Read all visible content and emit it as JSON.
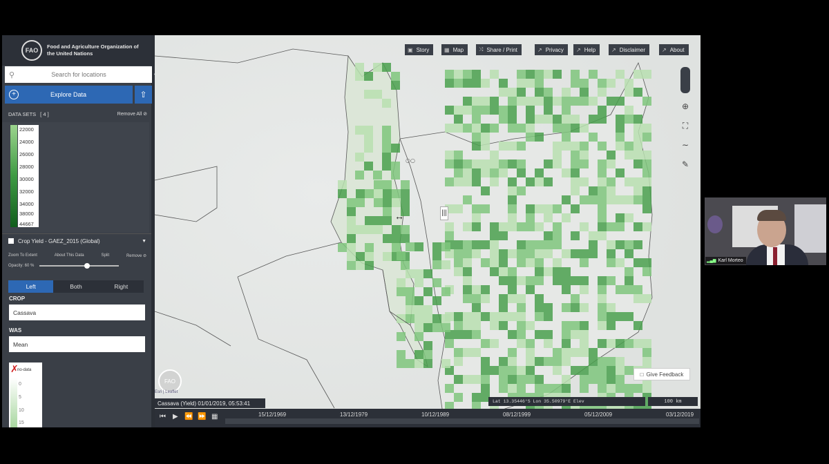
{
  "sidebar": {
    "org_name": "Food and Agriculture Organization of the United Nations",
    "logo_text": "FAO",
    "search_placeholder": "Search for locations",
    "explore_label": "Explore Data",
    "datasets_label": "DATA SETS",
    "datasets_count": "[ 4 ]",
    "remove_all": "Remove All",
    "legend_values": [
      "22000",
      "24000",
      "26000",
      "28000",
      "30000",
      "32000",
      "34000",
      "38000",
      "44667"
    ],
    "layer_title": "Crop Yield - GAEZ_2015 (Global)",
    "layer_actions": [
      "Zoom To Extent",
      "About This Data",
      "Split",
      "Remove"
    ],
    "opacity_label": "Opacity: 60 %",
    "opacity_value": 0.6,
    "split_tabs": [
      "Left",
      "Both",
      "Right"
    ],
    "crop_label": "CROP",
    "crop_value": "Cassava",
    "was_label": "WAS",
    "was_value": "Mean",
    "sub_legend": {
      "nodata": "no-data",
      "values": [
        "0",
        "5",
        "10",
        "15"
      ]
    }
  },
  "map": {
    "top_buttons": [
      {
        "label": "Story",
        "icon": "story-icon"
      },
      {
        "label": "Map",
        "icon": "map-icon"
      },
      {
        "label": "Share / Print",
        "icon": "share-icon"
      },
      {
        "label": "Privacy",
        "icon": "external-link-icon"
      },
      {
        "label": "Help",
        "icon": "external-link-icon"
      },
      {
        "label": "Disclaimer",
        "icon": "external-link-icon"
      },
      {
        "label": "About",
        "icon": "external-link-icon"
      }
    ],
    "feedback_label": "Give Feedback",
    "coords_text": "Lat  13.35446°S  Lon  35.50979°E  Elev",
    "scale_text": "100 km",
    "caption": "Cassava (Yield) 01/01/2019, 05:53:41",
    "attribution": "Esri | Leaflet",
    "colors": {
      "green_light": "#b8dfb0",
      "green_mid": "#7fc57c",
      "green_dark": "#4aa04e"
    }
  },
  "timeline": {
    "ticks": [
      "15/12/1969",
      "13/12/1979",
      "10/12/1989",
      "08/12/1999",
      "05/12/2009",
      "03/12/2019"
    ]
  },
  "webcam": {
    "name": "Karl Morteo"
  }
}
